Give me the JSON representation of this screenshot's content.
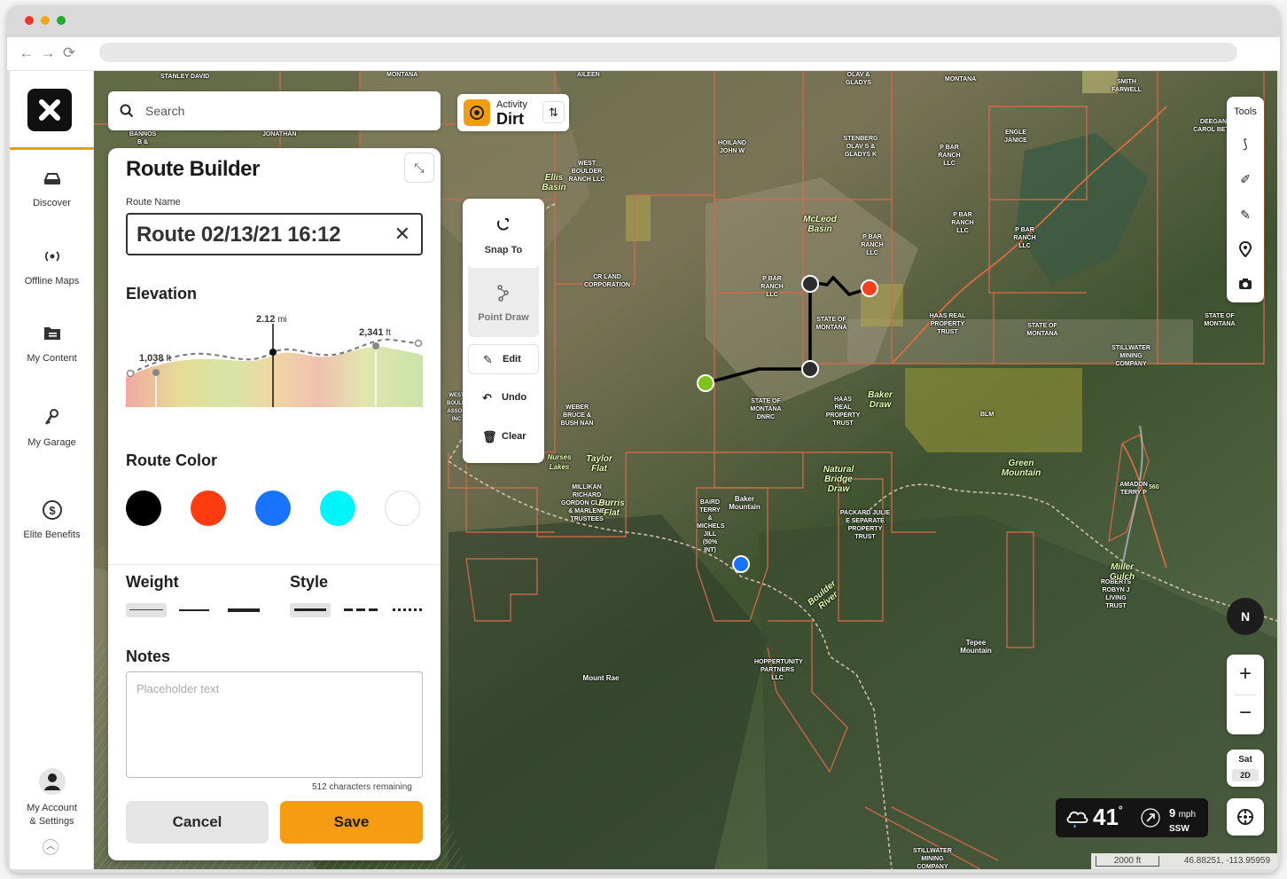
{
  "sidebar": {
    "items": [
      {
        "label": "Discover",
        "icon": "discover-icon"
      },
      {
        "label": "Offline Maps",
        "icon": "offline-maps-icon"
      },
      {
        "label": "My Content",
        "icon": "my-content-icon"
      },
      {
        "label": "My Garage",
        "icon": "my-garage-icon"
      },
      {
        "label": "Elite Benefits",
        "icon": "elite-benefits-icon"
      }
    ],
    "account": {
      "line1": "My Account",
      "line2": "& Settings"
    }
  },
  "search": {
    "placeholder": "Search"
  },
  "activity": {
    "label": "Activity",
    "value": "Dirt"
  },
  "route_builder": {
    "title": "Route Builder",
    "route_name_label": "Route Name",
    "route_name": "Route 02/13/21 16:12",
    "elevation_title": "Elevation",
    "elevation": {
      "min_value": "1,038",
      "min_unit": "ft",
      "distance_value": "2.12",
      "distance_unit": "mi",
      "max_value": "2,341",
      "max_unit": "ft"
    },
    "route_color_title": "Route Color",
    "colors": [
      "#000000",
      "#ff3b0f",
      "#1874ff",
      "#00f5fb",
      "#ffffff"
    ],
    "weight_title": "Weight",
    "style_title": "Style",
    "notes_title": "Notes",
    "notes_placeholder": "Placeholder text",
    "chars_remaining": "512 characters remaining",
    "cancel_label": "Cancel",
    "save_label": "Save"
  },
  "draw_tools": {
    "snap_to": "Snap To",
    "point_draw": "Point Draw",
    "edit": "Edit",
    "undo": "Undo",
    "clear": "Clear"
  },
  "tools": {
    "title": "Tools"
  },
  "map_controls": {
    "compass": "N",
    "layer_top": "Sat",
    "layer_bottom": "2D"
  },
  "weather": {
    "temp": "41",
    "wind_speed": "9",
    "wind_unit": "mph",
    "wind_dir": "SSW"
  },
  "scale": {
    "distance": "2000 ft",
    "coords": "46.88251, -113.95959"
  },
  "map_labels": [
    "STANLEY DAVID",
    "MONTANA",
    "AILEEN",
    "OLAV & GLADYS",
    "MONTANA",
    "SMITH FARWELL",
    "DEEGAN CAROL BETH",
    "ENGLE JANICE",
    "HOILAND JOHN W",
    "STENBERG OLAV S & GLADYS K",
    "P BAR RANCH LLC",
    "WEST BOULDER RANCH LLC",
    "Ellis Basin",
    "McLeod Basin",
    "P BAR RANCH LLC",
    "P BAR RANCH LLC",
    "P BAR RANCH LLC",
    "CR LAND CORPORATION",
    "P BAR RANCH LLC",
    "STATE OF MONTANA",
    "HAAS REAL PROPERTY TRUST",
    "STATE OF MONTANA",
    "STATE OF MONTANA",
    "STILLWATER MINING COMPANY",
    "STATE OF MONTANA DNRC",
    "HAAS REAL PROPERTY TRUST",
    "Baker Draw",
    "BLM",
    "WEBER BRUCE & BUSH NAN",
    "Taylor Flat",
    "Nurses Lakes",
    "Green Mountain",
    "AMADON TERRY P",
    "MILLIKAN RICHARD GORDON CLARK & MARLENE TRUSTEES",
    "Burris Flat",
    "BAIRD TERRY & MICHELS JILL (50% INT)",
    "Baker Mountain",
    "Natural Bridge Draw",
    "PACKARD JULIE E SEPARATE PROPERTY TRUST",
    "Boulder River",
    "ROBERTS ROBYN J LIVING TRUST",
    "Tepee Mountain",
    "HOPPERTUNITY PARTNERS LLC",
    "Mount Rae",
    "STILLWATER MINING COMPANY",
    "560",
    "BANNOS B &",
    "JONATHAN",
    "WEST BOULDER ASSOC INC",
    "Miller Gulch"
  ]
}
